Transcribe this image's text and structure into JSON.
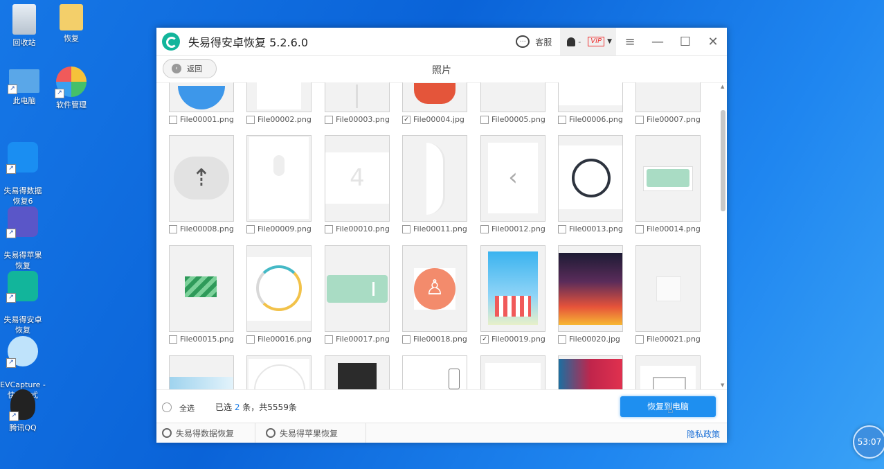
{
  "desktop": {
    "icons": [
      {
        "label": "回收站"
      },
      {
        "label": "恢复"
      },
      {
        "label": "此电脑"
      },
      {
        "label": "软件管理"
      },
      {
        "label": "失易得数据\n恢复6"
      },
      {
        "label": "失易得苹果\n恢复"
      },
      {
        "label": "失易得安卓\n恢复"
      },
      {
        "label": "EVCapture -\n快捷方式"
      },
      {
        "label": "腾讯QQ"
      }
    ],
    "clock": "53:07"
  },
  "window": {
    "title": "失易得安卓恢复  5.2.6.0",
    "service_label": "客服",
    "account_dash": "-",
    "vip_label": "VIP",
    "back_label": "返回",
    "page_title": "照片",
    "files": [
      {
        "name": "File00001.png",
        "checked": false
      },
      {
        "name": "File00002.png",
        "checked": false
      },
      {
        "name": "File00003.png",
        "checked": false
      },
      {
        "name": "File00004.jpg",
        "checked": true
      },
      {
        "name": "File00005.png",
        "checked": false
      },
      {
        "name": "File00006.png",
        "checked": false
      },
      {
        "name": "File00007.png",
        "checked": false
      },
      {
        "name": "File00008.png",
        "checked": false
      },
      {
        "name": "File00009.png",
        "checked": false
      },
      {
        "name": "File00010.png",
        "checked": false
      },
      {
        "name": "File00011.png",
        "checked": false
      },
      {
        "name": "File00012.png",
        "checked": false
      },
      {
        "name": "File00013.png",
        "checked": false
      },
      {
        "name": "File00014.png",
        "checked": false
      },
      {
        "name": "File00015.png",
        "checked": false
      },
      {
        "name": "File00016.png",
        "checked": false
      },
      {
        "name": "File00017.png",
        "checked": false
      },
      {
        "name": "File00018.png",
        "checked": false
      },
      {
        "name": "File00019.png",
        "checked": true
      },
      {
        "name": "File00020.jpg",
        "checked": false
      },
      {
        "name": "File00021.png",
        "checked": false
      }
    ],
    "select_all_label": "全选",
    "selected_prefix": "已选 ",
    "selected_count": "2",
    "selected_suffix": " 条，共5559条",
    "recover_button": "恢复到电脑",
    "footer": {
      "data_recovery": "失易得数据恢复",
      "apple_recovery": "失易得苹果恢复",
      "privacy": "隐私政策"
    }
  },
  "colors": {
    "accent": "#1e8ff0",
    "brand": "#12b59b"
  }
}
